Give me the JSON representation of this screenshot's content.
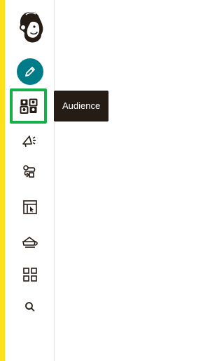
{
  "brand": {
    "logo_icon": "mailchimp-freddie-logo",
    "strip_color": "#ffe01b"
  },
  "nav": {
    "create": {
      "icon": "pencil-icon",
      "color": "#007c89"
    },
    "items": [
      {
        "id": "audience",
        "icon": "audience-icon",
        "active": true
      },
      {
        "id": "campaigns",
        "icon": "megaphone-icon",
        "active": false
      },
      {
        "id": "automations",
        "icon": "automation-flow-icon",
        "active": false
      },
      {
        "id": "website",
        "icon": "website-cursor-icon",
        "active": false
      },
      {
        "id": "content",
        "icon": "content-studio-icon",
        "active": false
      },
      {
        "id": "integrations",
        "icon": "grid-icon",
        "active": false
      },
      {
        "id": "search",
        "icon": "search-icon",
        "active": false
      }
    ],
    "active_border_color": "#15b04a"
  },
  "tooltip": {
    "text": "Audience",
    "background": "#241c15"
  }
}
